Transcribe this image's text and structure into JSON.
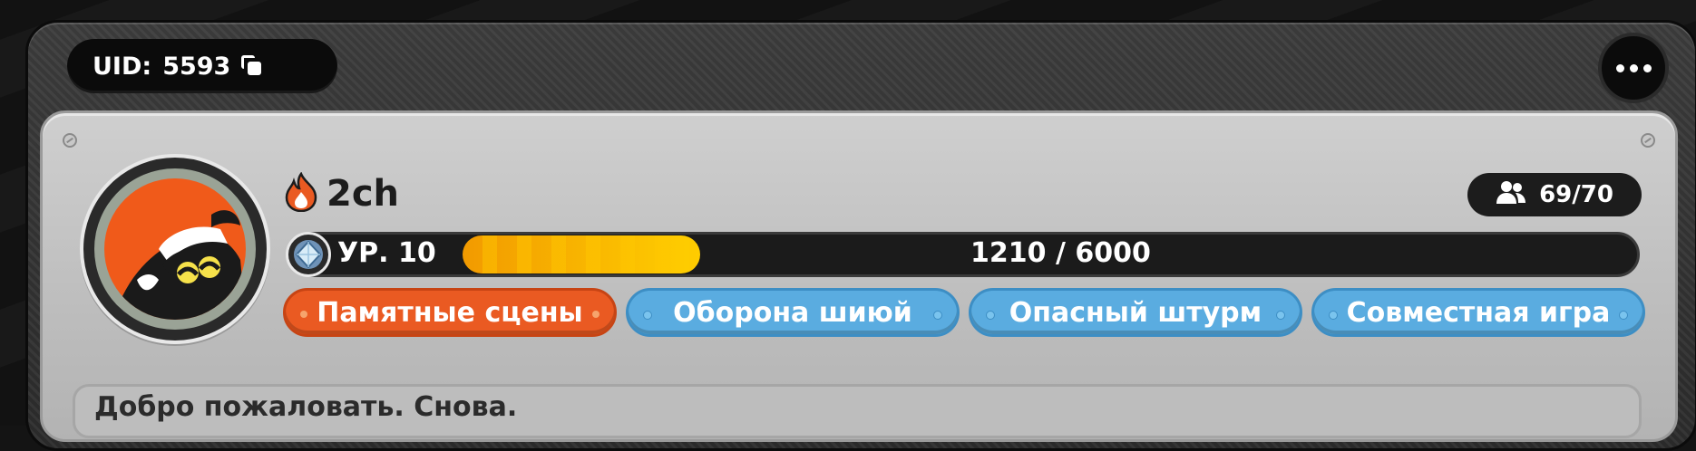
{
  "header": {
    "uid_label": "UID:",
    "uid_value": "5593",
    "copy_icon": "copy-icon",
    "menu_icon": "more-horizontal-icon"
  },
  "profile": {
    "name": "2ch",
    "name_icon": "flame-icon",
    "friends": "69/70",
    "friends_icon": "users-icon",
    "level_icon": "diamond-icon",
    "level_label": "УР. 10",
    "xp_text": "1210 / 6000",
    "xp_current": 1210,
    "xp_max": 6000
  },
  "modes": [
    {
      "label": "Памятные сцены",
      "color": "#ea5a22",
      "active": true
    },
    {
      "label": "Оборона шиюй",
      "color": "#5aace0",
      "active": false
    },
    {
      "label": "Опасный штурм",
      "color": "#5aace0",
      "active": false
    },
    {
      "label": "Совместная игра",
      "color": "#5aace0",
      "active": false
    }
  ],
  "welcome": {
    "message": "Добро пожаловать. Снова."
  },
  "colors": {
    "accent_orange": "#ea5a22",
    "accent_blue": "#5aace0",
    "xp_yellow": "#ffcf00",
    "panel": "#c4c4c4",
    "frame": "#333333"
  }
}
